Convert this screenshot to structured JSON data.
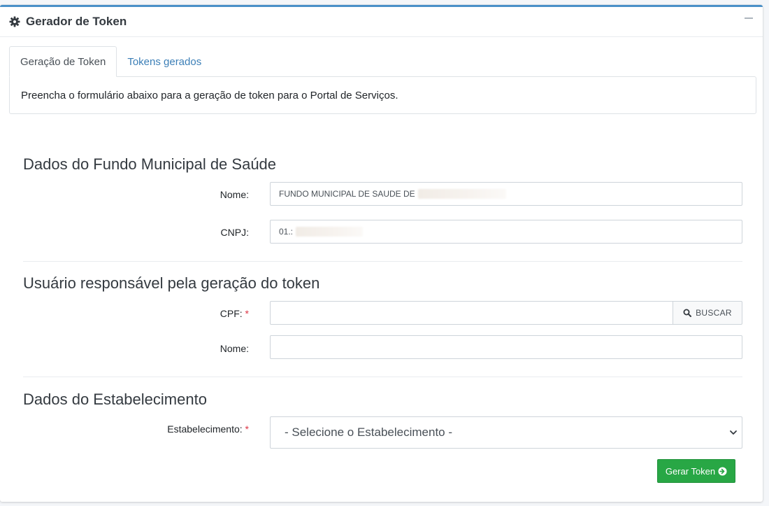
{
  "card": {
    "title": "Gerador de Token",
    "icon": "gear-icon",
    "accent_color": "#4a90c8"
  },
  "tabs": [
    {
      "label": "Geração de Token",
      "active": true
    },
    {
      "label": "Tokens gerados",
      "active": false
    }
  ],
  "info": {
    "text": "Preencha o formulário abaixo para a geração de token para o Portal de Serviços."
  },
  "fundo": {
    "title": "Dados do Fundo Municipal de Saúde",
    "nome_label": "Nome:",
    "nome_value": "FUNDO MUNICIPAL DE SAUDE DE",
    "cnpj_label": "CNPJ:",
    "cnpj_value": "01.:"
  },
  "usuario": {
    "title": "Usuário responsável pela geração do token",
    "cpf_label": "CPF:",
    "required_mark": "*",
    "cpf_value": "",
    "buscar_label": "BUSCAR",
    "nome_label": "Nome:",
    "nome_value": ""
  },
  "estabelecimento": {
    "title": "Dados do Estabelecimento",
    "label": "Estabelecimento:",
    "required_mark": "*",
    "selected": "- Selecione o Estabelecimento -"
  },
  "actions": {
    "gerar_label": "Gerar Token",
    "gerar_color": "#28a745"
  }
}
